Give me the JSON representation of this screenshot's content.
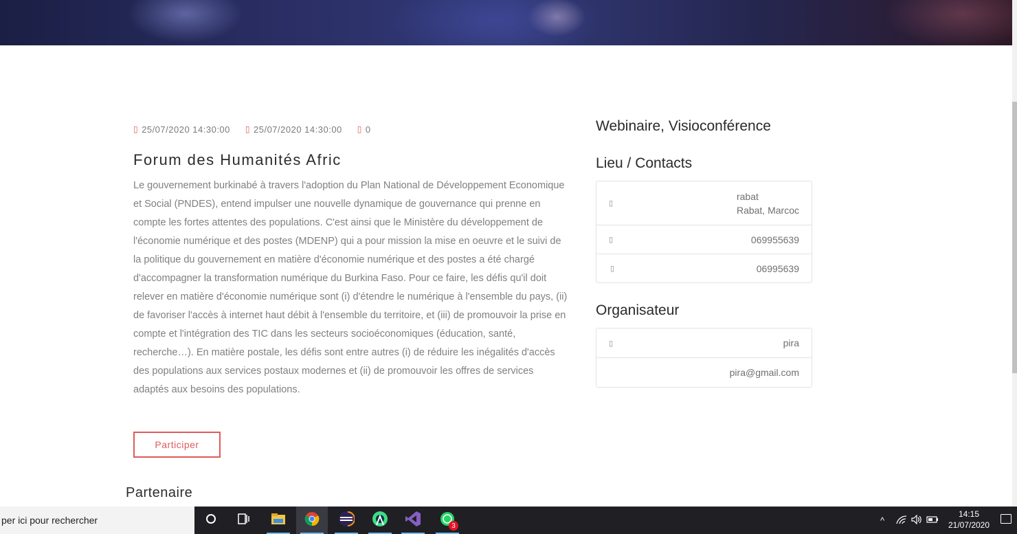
{
  "event": {
    "start_date": "25/07/2020 14:30:00",
    "end_date": "25/07/2020 14:30:00",
    "count": "0",
    "title": "Forum des Humanités Afric",
    "description": "Le gouvernement burkinabé à travers l'adoption du Plan National de Développement Economique et Social (PNDES), entend impulser une nouvelle dynamique de gouvernance qui prenne en compte les fortes attentes des populations. C'est ainsi que le Ministère du développement de l'économie numérique et des postes (MDENP) qui a pour mission la mise en oeuvre et le suivi de la politique du gouvernement en matière d'économie numérique et des postes a été chargé d'accompagner la transformation numérique du Burkina Faso. Pour ce faire, les défis qu'il doit relever en matière d'économie numérique sont (i) d'étendre le numérique à l'ensemble du pays, (ii) de favoriser l'accès à internet haut débit à l'ensemble du territoire, et (iii) de promouvoir la prise en compte et l'intégration des TIC dans les secteurs socioéconomiques (éducation, santé, recherche…). En matière postale, les défis sont entre autres (i) de réduire les inégalités d'accès des populations aux services postaux modernes et (ii) de promouvoir les offres de services adaptés aux besoins des populations.",
    "participate_label": "Participer",
    "partner_heading": "Partenaire"
  },
  "sidebar": {
    "event_type": "Webinaire, Visioconférence",
    "location_heading": "Lieu / Contacts",
    "location": {
      "city": "rabat",
      "address": "Rabat, Marcoc",
      "phone": "069955639",
      "mobile": "06995639"
    },
    "organizer_heading": "Organisateur",
    "organizer": {
      "name": "pira",
      "email": "pira@gmail.com"
    }
  },
  "taskbar": {
    "search_placeholder": "per ici pour rechercher",
    "apps": [
      "cortana-icon",
      "task-view-icon",
      "file-explorer-icon",
      "chrome-icon",
      "eclipse-icon",
      "android-studio-icon",
      "visual-studio-icon",
      "whatsapp-icon"
    ],
    "whatsapp_badge": "3",
    "time": "14:15",
    "date": "21/07/2020"
  },
  "colors": {
    "accent": "#e05a5a",
    "taskbar": "#202024"
  }
}
